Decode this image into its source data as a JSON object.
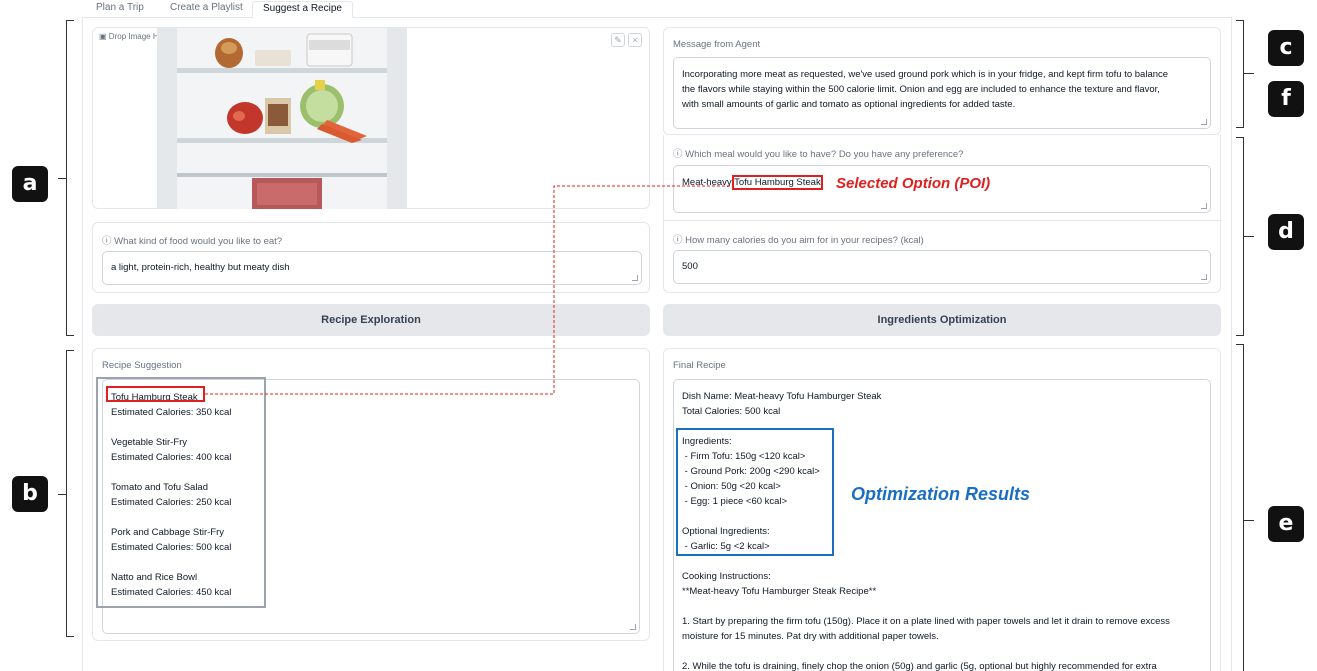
{
  "tabs": [
    "Plan a Trip",
    "Create a Playlist",
    "Suggest a Recipe"
  ],
  "upload": {
    "label": "Drop Image Here - or - Click to Upload",
    "edit_icon": "pencil-icon",
    "clear_icon": "close-icon"
  },
  "food_question": {
    "label": "What kind of food would you like to eat?",
    "value": "a light, protein-rich, healthy but meaty dish"
  },
  "recipe_exploration_button": "Recipe Exploration",
  "recipe_suggestion": {
    "label": "Recipe Suggestion",
    "items": [
      {
        "name": "Tofu Hamburg Steak",
        "calories": "Estimated Calories: 350 kcal"
      },
      {
        "name": "Vegetable Stir-Fry",
        "calories": "Estimated Calories: 400 kcal"
      },
      {
        "name": "Tomato and Tofu Salad",
        "calories": "Estimated Calories: 250 kcal"
      },
      {
        "name": "Pork and Cabbage Stir-Fry",
        "calories": "Estimated Calories: 500 kcal"
      },
      {
        "name": "Natto and Rice Bowl",
        "calories": "Estimated Calories: 450 kcal"
      }
    ]
  },
  "agent_message": {
    "label": "Message from Agent",
    "lines": [
      "Incorporating more meat as requested, we've used ground pork which is in your fridge, and kept firm tofu to balance",
      "the flavors while staying within the 500 calorie limit. Onion and egg are included to enhance the texture and flavor,",
      "with small amounts of garlic and tomato as optional ingredients for added taste."
    ]
  },
  "meal_question": {
    "label": "Which meal would you like to have? Do you have any preference?",
    "value_prefix": "Meat-heavy ",
    "value_highlight": "Tofu Hamburg Steak"
  },
  "calorie_question": {
    "label": "How many calories do you aim for in your recipes? (kcal)",
    "value": "500"
  },
  "ingredients_button": "Ingredients Optimization",
  "final_recipe": {
    "label": "Final Recipe",
    "dish_name": "Dish Name: Meat-heavy Tofu Hamburger Steak",
    "total_calories": "Total Calories: 500 kcal",
    "ingredients_header": "Ingredients:",
    "ingredients": [
      " - Firm Tofu: 150g <120 kcal>",
      " - Ground Pork: 200g <290 kcal>",
      " - Onion: 50g <20 kcal>",
      " - Egg: 1 piece <60 kcal>"
    ],
    "optional_header": "Optional Ingredients:",
    "optional": [
      " - Garlic: 5g <2 kcal>"
    ],
    "instructions_header": "Cooking Instructions:",
    "instructions_title": "**Meat-heavy Tofu Hamburger Steak Recipe**",
    "step1_a": "1. Start by preparing the firm tofu (150g). Place it on a plate lined with paper towels and let it drain to remove excess",
    "step1_b": "moisture for 15 minutes. Pat dry with additional paper towels.",
    "step2_a": "2. While the tofu is draining, finely chop the onion (50g) and garlic (5g, optional but highly recommended for extra"
  },
  "annotations": {
    "selected_option": "Selected Option (POI)",
    "optimization_results": "Optimization Results",
    "letters": [
      "a",
      "b",
      "c",
      "f",
      "d",
      "e"
    ]
  }
}
